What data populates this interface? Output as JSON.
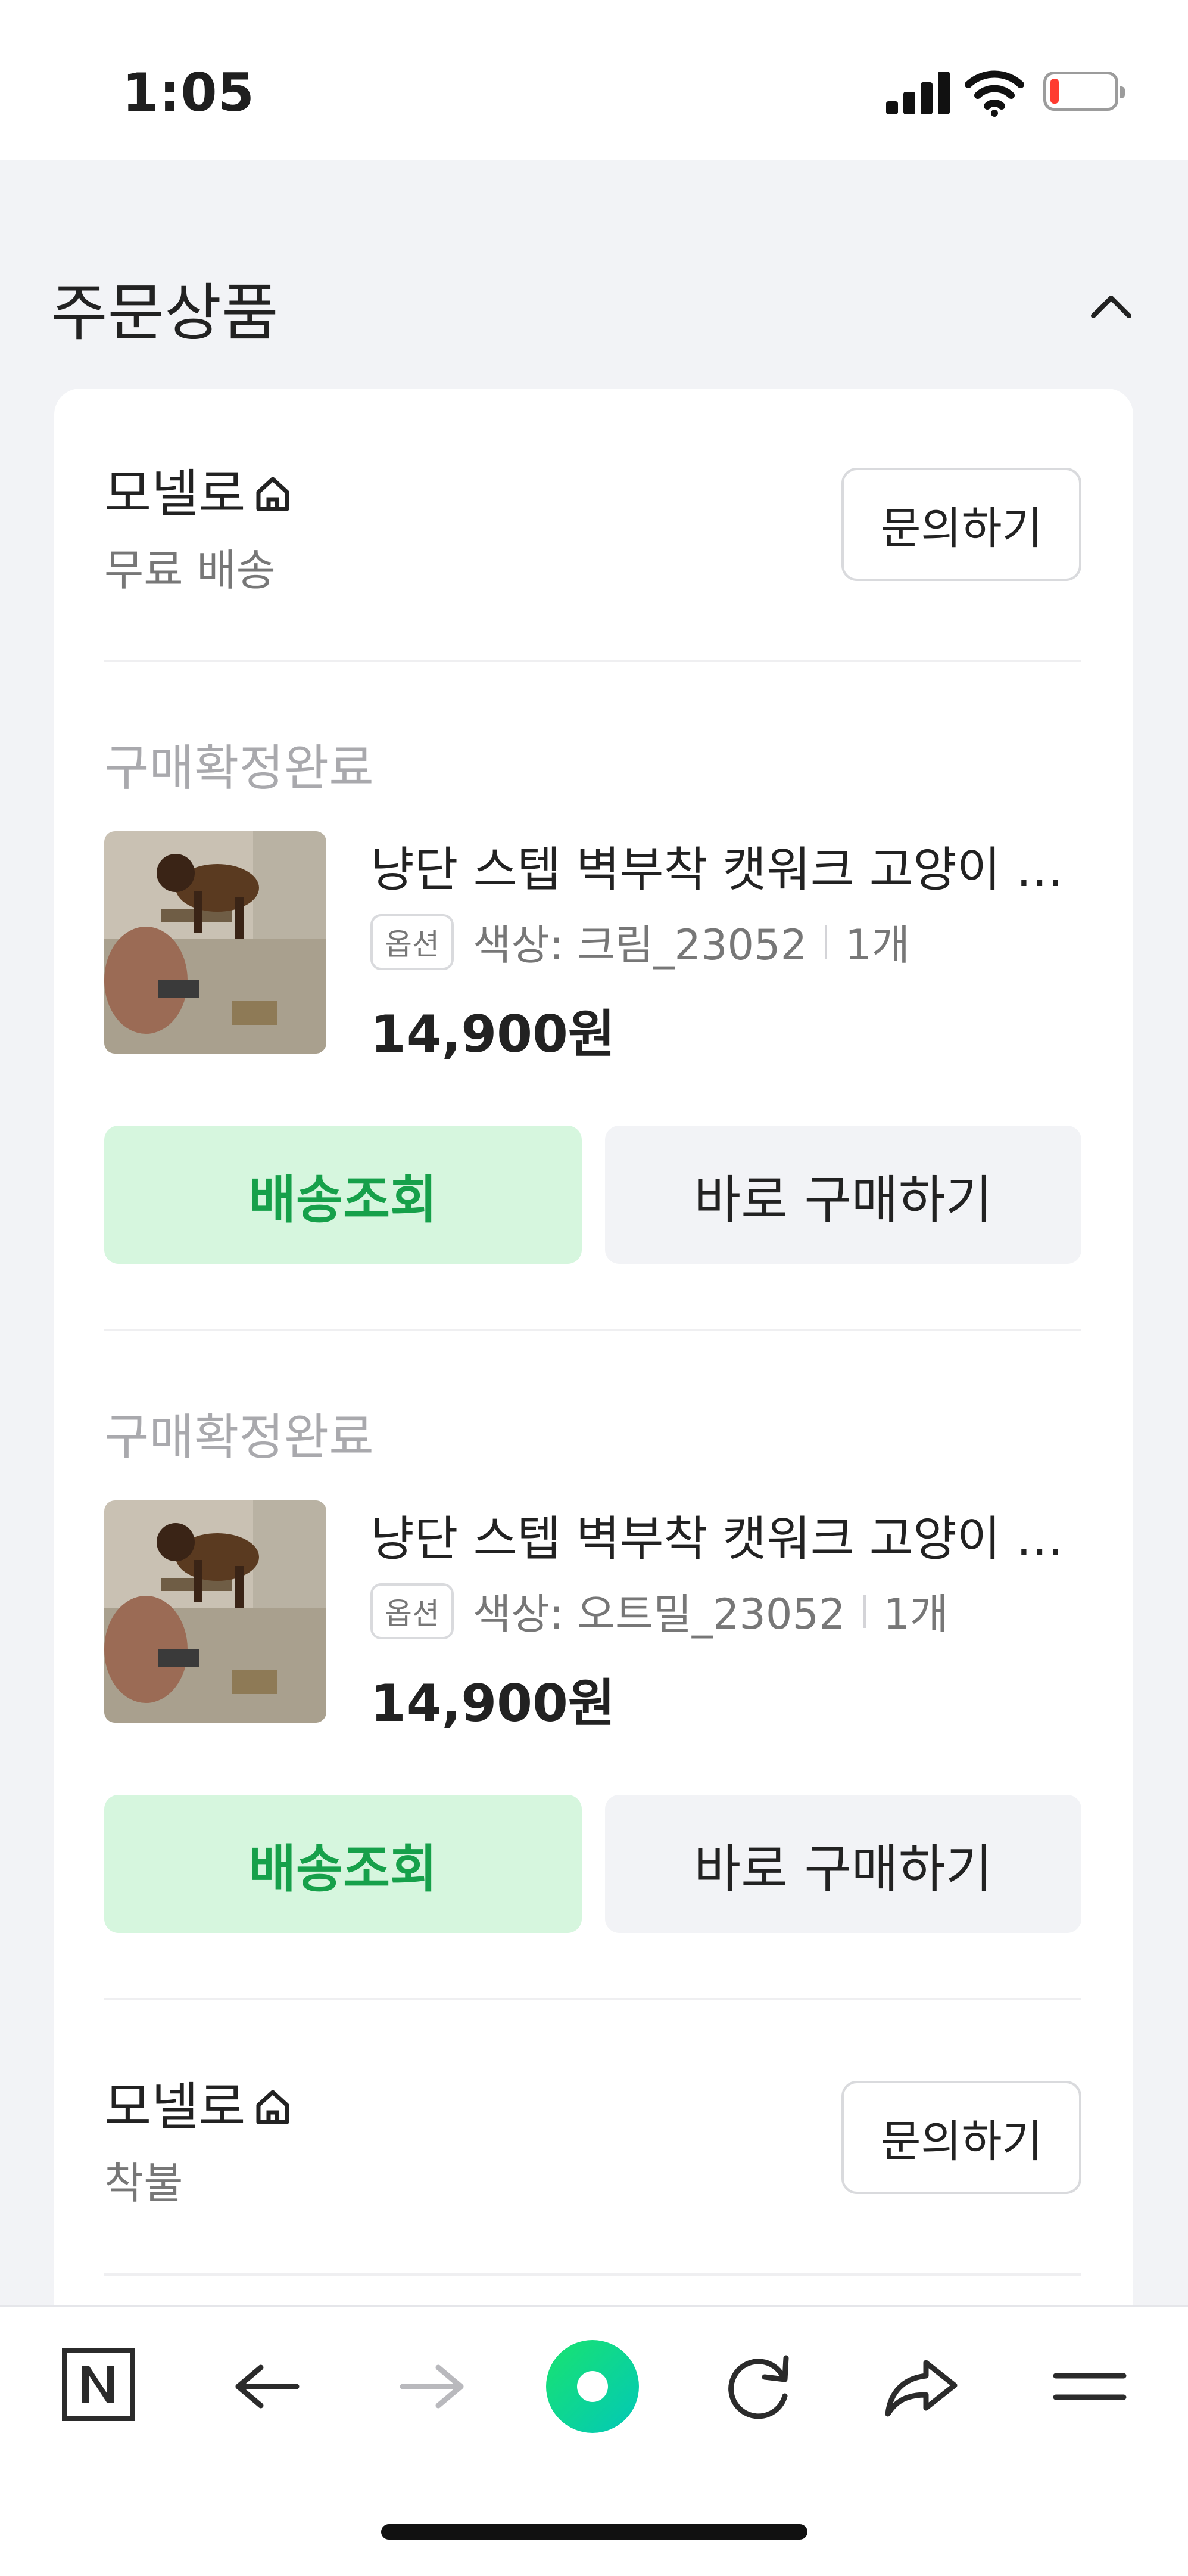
{
  "status_bar": {
    "time": "1:05",
    "battery_level_pct": 5
  },
  "section": {
    "title": "주문상품"
  },
  "sellers": [
    {
      "name": "모넬로",
      "shipping": "무료 배송",
      "inquiry_label": "문의하기"
    },
    {
      "name": "모넬로",
      "shipping": "착불",
      "inquiry_label": "문의하기"
    }
  ],
  "items": [
    {
      "status": "구매확정완료",
      "name": "냥단 스텝 벽부착 캣워크 고양이 …",
      "option_badge": "옵션",
      "option": "색상: 크림_23052",
      "qty": "1개",
      "price": "14,900원",
      "track_label": "배송조회",
      "buy_label": "바로 구매하기"
    },
    {
      "status": "구매확정완료",
      "name": "냥단 스텝 벽부착 캣워크 고양이 …",
      "option_badge": "옵션",
      "option": "색상: 오트밀_23052",
      "qty": "1개",
      "price": "14,900원",
      "track_label": "배송조회",
      "buy_label": "바로 구매하기"
    }
  ],
  "bottom_nav": {
    "icons": [
      "naver-n-icon",
      "back-arrow-icon",
      "forward-arrow-icon",
      "green-dot-icon",
      "refresh-icon",
      "share-icon",
      "menu-icon"
    ]
  },
  "colors": {
    "accent_green": "#16a04a",
    "track_bg": "#d6f6de",
    "page_bg": "#f2f3f6"
  }
}
